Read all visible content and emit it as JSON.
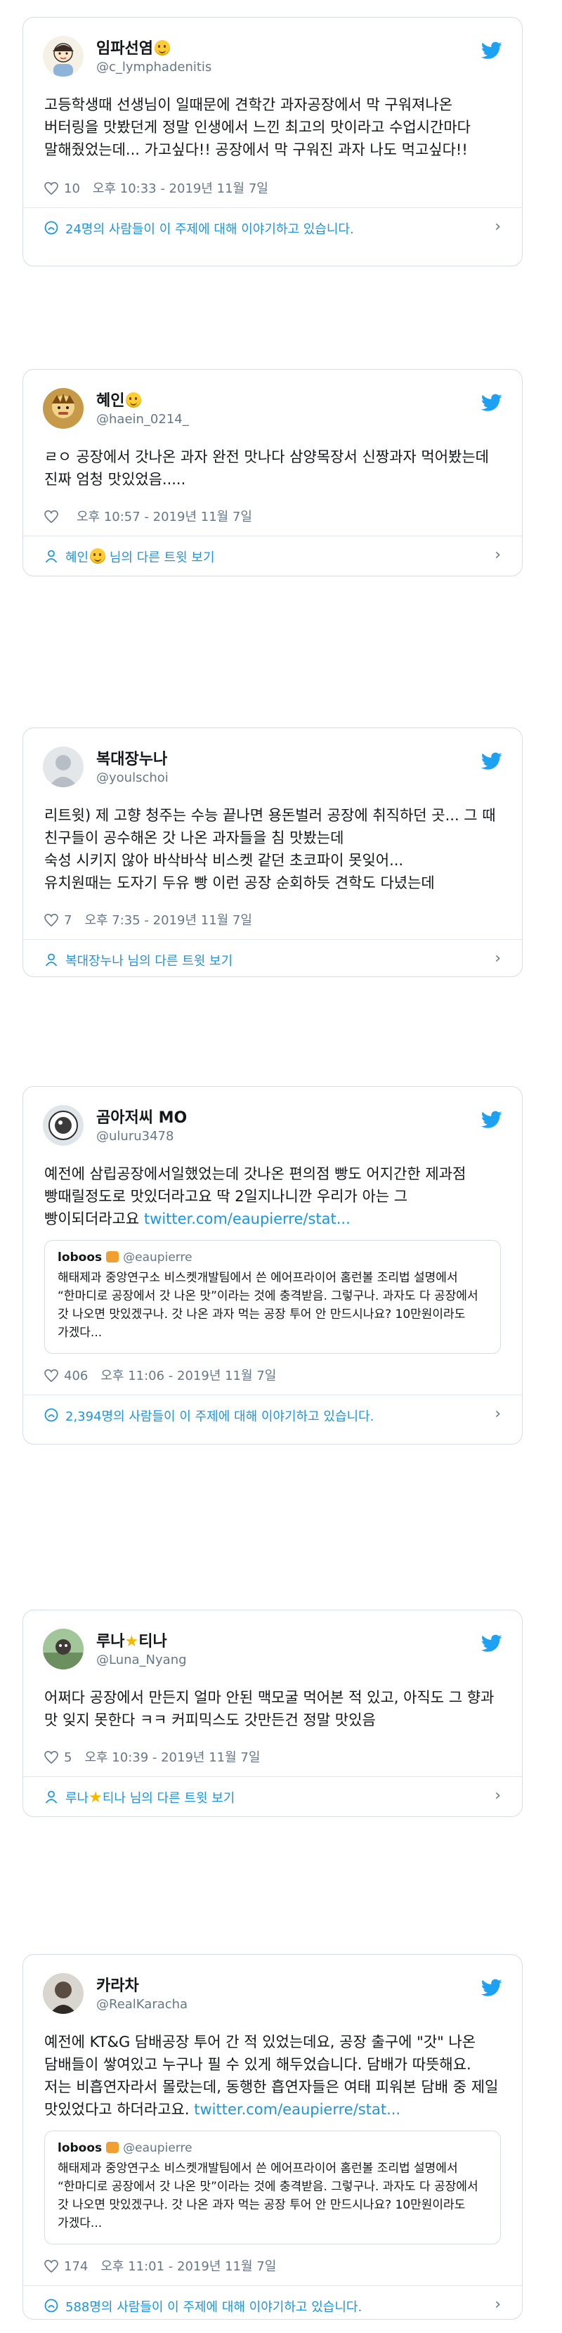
{
  "tweets": [
    {
      "name": "임파선염",
      "handle": "@c_lymphadenitis",
      "name_emoji": true,
      "text": "고등학생때 선생님이 일때문에 견학간 과자공장에서 막 구워져나온 버터링을 맛봤던게 정말 인생에서 느낀 최고의 맛이라고 수업시간마다 말해줬었는데... 가고싶다!! 공장에서 막 구워진 과자 나도 먹고싶다!!",
      "likes": "10",
      "time": "오후 10:33 - 2019년 11월 7일",
      "footer": "24명의 사람들이 이 주제에 대해 이야기하고 있습니다."
    },
    {
      "name": "혜인",
      "handle": "@haein_0214_",
      "name_emoji": true,
      "text": "ㄹㅇ 공장에서 갓나온 과자 완전 맛나다 삼양목장서 신짱과자 먹어봤는데 진짜 엄청 맛있었음.....",
      "likes": "",
      "time": "오후 10:57 - 2019년 11월 7일",
      "footer_name": "혜인",
      "footer_suffix": "님의 다른 트윗 보기"
    },
    {
      "name": "복대장누나",
      "handle": "@youlschoi",
      "text": "리트윗) 제 고향 청주는 수능 끝나면 용돈벌러 공장에 취직하던 곳... 그 때 친구들이 공수해온 갓 나온 과자들을 침 맛봤는데\n숙성 시키지  않아 바삭바삭 비스켓 같던 초코파이 못잊어...\n유치원때는 도자기 두유 빵 이런 공장 순회하듯 견학도 다녔는데",
      "likes": "7",
      "time": "오후 7:35 - 2019년 11월 7일",
      "footer": "복대장누나 님의 다른 트윗 보기"
    },
    {
      "name": "곰아저씨 MO",
      "handle": "@uluru3478",
      "text": "예전에 삼립공장에서일했었는데 갓나온 편의점 빵도 어지간한 제과점 빵때릴정도로 맛있더라고요  딱 2일지나니깐 우리가 아는 그 빵이되더라고요 ",
      "link": "twitter.com/eaupierre/stat...",
      "quote": {
        "name": "loboos",
        "handle": "@eaupierre",
        "text": "해태제과 중앙연구소 비스켓개발팀에서 쓴 에어프라이어 홈런볼 조리법 설명에서 “한마디로 공장에서 갓 나온 맛”이라는 것에 충격받음. 그렇구나. 과자도 다 공장에서 갓 나오면 맛있겠구나. 갓 나온 과자 먹는 공장 투어 안 만드시나요? 10만원이라도 가겠다..."
      },
      "likes": "406",
      "time": "오후 11:06 - 2019년 11월 7일",
      "footer": "2,394명의 사람들이 이 주제에 대해 이야기하고 있습니다."
    },
    {
      "name_pre": "루나",
      "name_post": "티나",
      "handle": "@Luna_Nyang",
      "text": "어쩌다 공장에서 만든지 얼마 안된 맥모굴 먹어본 적 있고, 아직도 그 향과 맛 잊지 못한다 ㅋㅋ 커피믹스도 갓만든건 정말 맛있음",
      "likes": "5",
      "time": "오후 10:39 - 2019년 11월 7일",
      "footer_pre": "루나",
      "footer_post": "티나 님의 다른 트윗 보기"
    },
    {
      "name": "카라차",
      "handle": "@RealKaracha",
      "text": "예전에 KT&G 담배공장 투어 간 적 있었는데요, 공장 출구에 \"갓\" 나온 담배들이 쌓여있고 누구나 필 수 있게 해두었습니다. 담배가 따뜻해요. 저는 비흡연자라서 몰랐는데, 동행한 흡연자들은 여태 피워본 담배 중 제일 맛있었다고 하더라고요. ",
      "link": "twitter.com/eaupierre/stat...",
      "quote": {
        "name": "loboos",
        "handle": "@eaupierre",
        "text": "해태제과 중앙연구소 비스켓개발팀에서 쓴 에어프라이어 홈런볼 조리법 설명에서 “한마디로 공장에서 갓 나온 맛”이라는 것에 충격받음. 그렇구나. 과자도 다 공장에서 갓 나오면 맛있겠구나. 갓 나온 과자 먹는 공장 투어 안 만드시나요? 10만원이라도 가겠다..."
      },
      "likes": "174",
      "time": "오후 11:01 - 2019년 11월 7일",
      "footer": "588명의 사람들이 이 주제에 대해 이야기하고 있습니다."
    }
  ],
  "colors": {
    "twitter_blue": "#1da1f2",
    "link_blue": "#1b95e0",
    "meta_gray": "#657786"
  },
  "icons": [
    "twitter-bird-icon",
    "heart-icon",
    "info-icon",
    "person-icon",
    "chevron-right-icon"
  ]
}
